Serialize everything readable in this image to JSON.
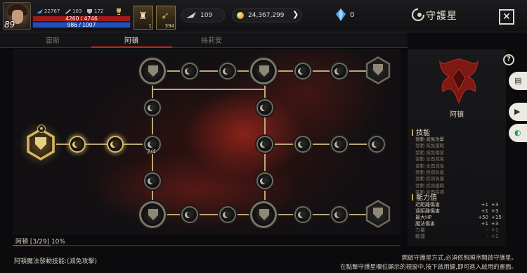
{
  "player": {
    "level": "89",
    "stat_a": "22767",
    "stat_b": "103",
    "stat_c": "172",
    "hp": "4260 / 4746",
    "mp": "986 / 1007"
  },
  "inventory_slots": [
    {
      "count": "1"
    },
    {
      "count": "394"
    }
  ],
  "currency": {
    "feather": "109",
    "gold": "24,367,299",
    "crystal": "0"
  },
  "header": {
    "title": "守護星",
    "close": "✕"
  },
  "tabs": [
    {
      "label": "宙斯",
      "active": false
    },
    {
      "label": "阿頓",
      "active": true
    },
    {
      "label": "絲莉安",
      "active": false
    }
  ],
  "map": {
    "branch_counter": "2/4"
  },
  "progress": {
    "label": "阿頓 [3/29] 10%",
    "fraction": 0.1
  },
  "footer": {
    "left": "阿頓魔法發動技能:(減免攻擊)",
    "right_line1": "開啟守護星方式,必須依照順序開啟守護星。",
    "right_line2": "在點擊守護星欄位顯示的視窗中,按下啟用鍵,即可進入啟用的畫面。"
  },
  "panel": {
    "name": "阿頓",
    "help": "?",
    "skills_title": "技能",
    "skills": [
      "發動 減免攻擊",
      "發動 減免護範",
      "發動 減免傷害",
      "發動 全面減免",
      "發動 全面減免",
      "發動 疾病負量",
      "發動 疾病負量",
      "發動 疾病護範",
      "發動 全面疾病"
    ],
    "stats_title": "能力值",
    "stats": [
      {
        "name": "近距離傷害",
        "current": "+1",
        "next": "+3",
        "dim": false
      },
      {
        "name": "遠距離傷害",
        "current": "+1",
        "next": "+3",
        "dim": false
      },
      {
        "name": "最大HP",
        "current": "+50",
        "next": "+15",
        "dim": false
      },
      {
        "name": "魔法傷害",
        "current": "+1",
        "next": "+3",
        "dim": false
      },
      {
        "name": "力量",
        "current": "-",
        "next": "+1",
        "dim": true
      },
      {
        "name": "敏捷",
        "current": "-",
        "next": "+1",
        "dim": true
      }
    ]
  },
  "colors": {
    "accent_red": "#c42a1c",
    "gold": "#d7b45c",
    "hp": "#a11a1a",
    "mp": "#1f4fbf"
  }
}
